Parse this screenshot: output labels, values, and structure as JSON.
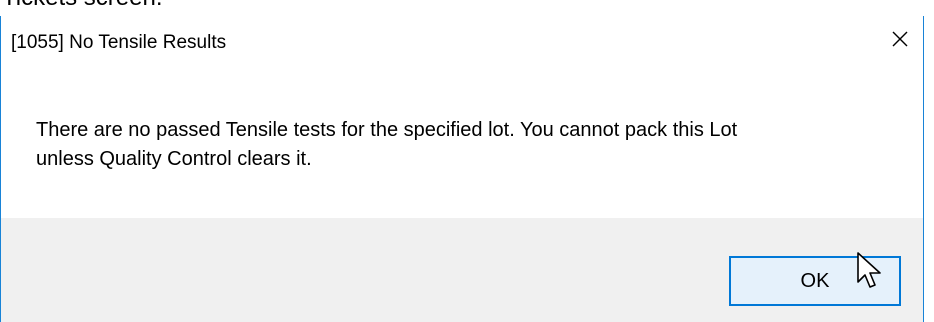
{
  "background_text": "Tickets screen.",
  "dialog": {
    "title": "[1055] No Tensile Results",
    "close_icon": "close-icon",
    "message_line1": "There are no passed Tensile tests for the specified lot. You cannot pack this Lot",
    "message_line2": "unless Quality Control clears it.",
    "ok_label": "OK"
  },
  "colors": {
    "window_border": "#1883d7",
    "button_area": "#f0f0f0",
    "ok_button_fill": "#e5f1fb",
    "ok_button_border": "#0078d7"
  }
}
